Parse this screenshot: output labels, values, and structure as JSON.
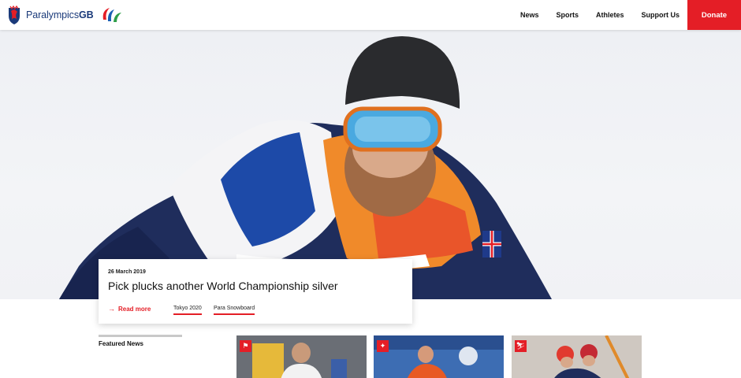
{
  "header": {
    "logo_text_main": "Paralympics",
    "logo_text_bold": "GB",
    "nav": [
      "News",
      "Sports",
      "Athletes",
      "Support Us"
    ],
    "donate_label": "Donate"
  },
  "hero": {
    "date": "26 March 2019",
    "title": "Pick plucks another World Championship silver",
    "read_more": "Read more",
    "tags": [
      "Tokyo 2020",
      "Para Snowboard"
    ]
  },
  "featured": {
    "label": "Featured News",
    "thumbnails": [
      {
        "icon": "powerlifting-icon"
      },
      {
        "icon": "table-tennis-icon"
      },
      {
        "icon": "skiing-icon"
      }
    ]
  },
  "colors": {
    "accent": "#e41e26",
    "logo_blue": "#1a3a7a"
  }
}
